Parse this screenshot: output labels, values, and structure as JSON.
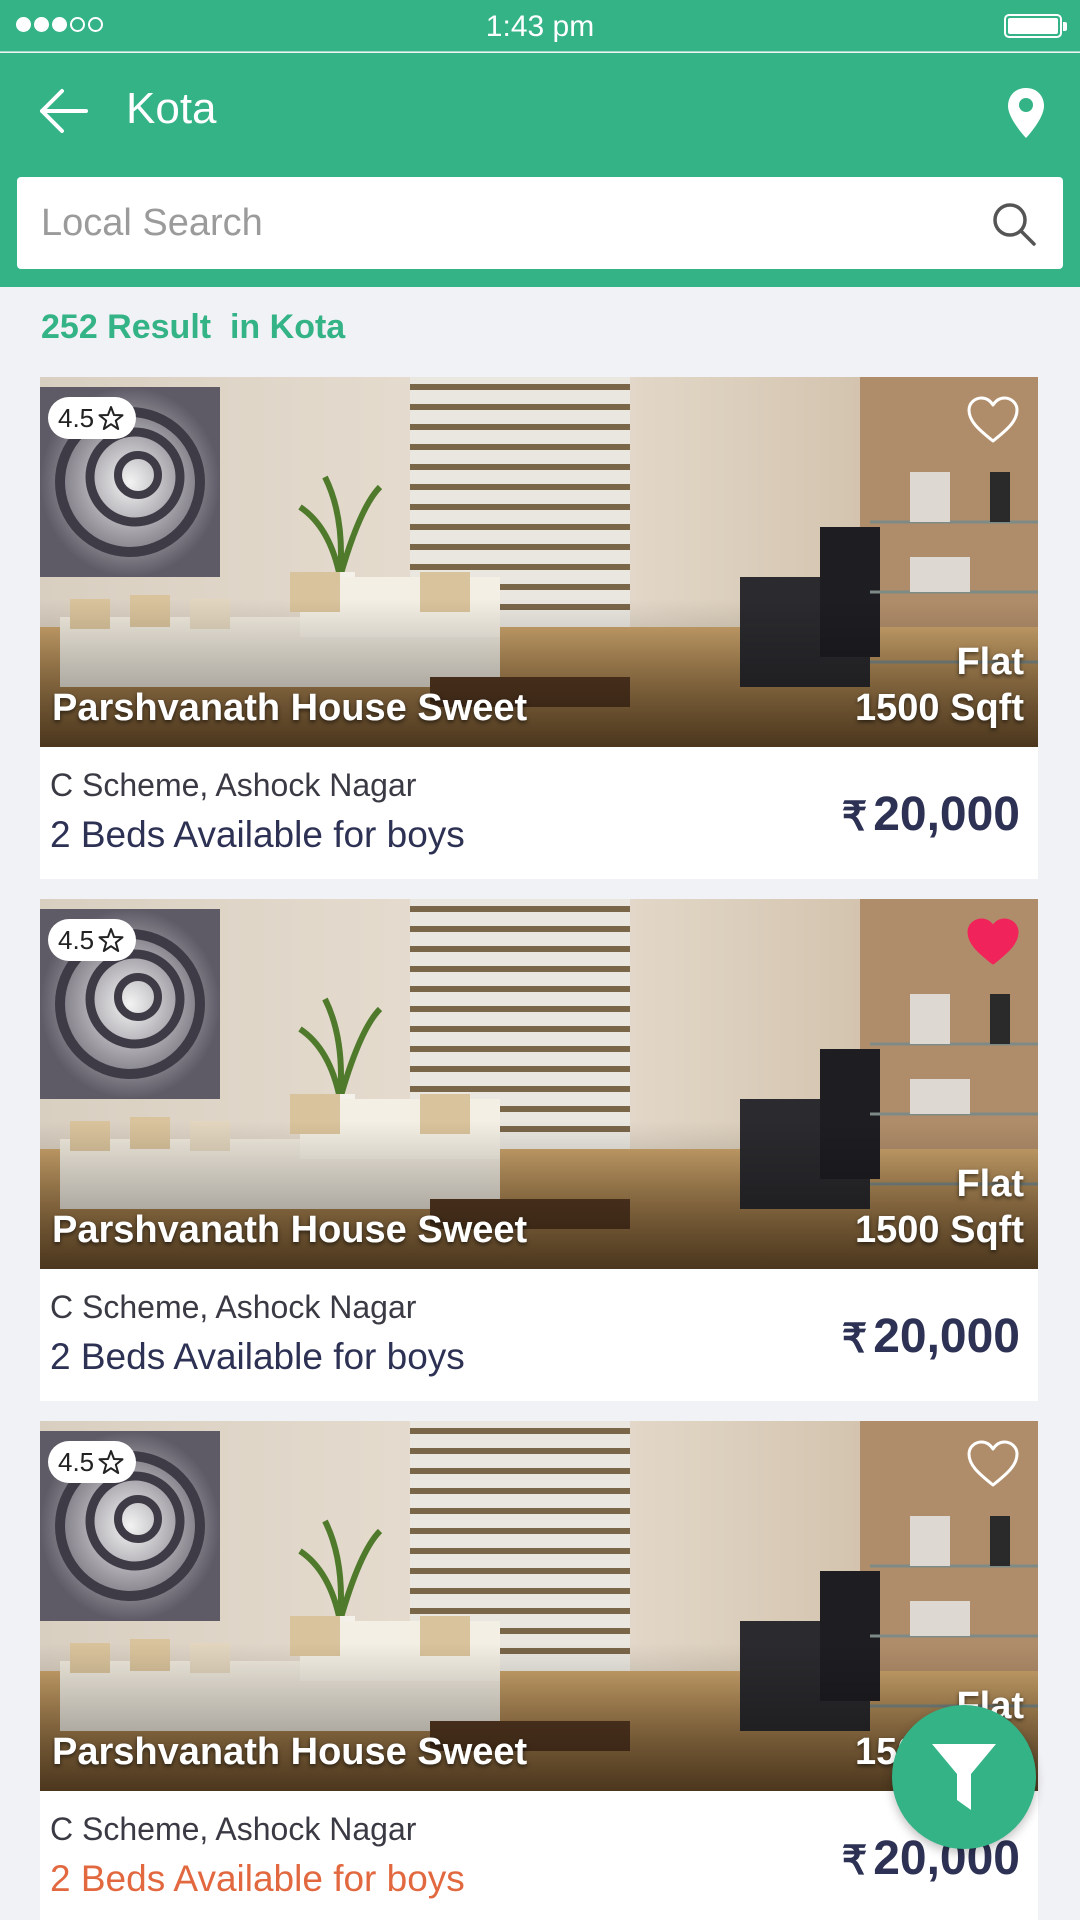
{
  "status_bar": {
    "time": "1:43 pm"
  },
  "header": {
    "title": "Kota"
  },
  "search": {
    "placeholder": "Local Search"
  },
  "results": {
    "summary": "252 Result  in Kota"
  },
  "listings": [
    {
      "rating": "4.5",
      "name": "Parshvanath House Sweet",
      "type": "Flat",
      "area": "1500 Sqft",
      "address": "C Scheme, Ashock Nagar",
      "beds": "2 Beds Available for boys",
      "currency": "₹",
      "price": "20,000",
      "favorited": false
    },
    {
      "rating": "4.5",
      "name": "Parshvanath House Sweet",
      "type": "Flat",
      "area": "1500 Sqft",
      "address": "C Scheme, Ashock Nagar",
      "beds": "2 Beds Available for boys",
      "currency": "₹",
      "price": "20,000",
      "favorited": true
    },
    {
      "rating": "4.5",
      "name": "Parshvanath House Sweet",
      "type": "Flat",
      "area": "1500 Sqft",
      "address": "C Scheme, Ashock Nagar",
      "beds": "2 Beds Available for boys",
      "currency": "₹",
      "price": "20,000",
      "favorited": false
    }
  ],
  "icons": {
    "back": "back-arrow-icon",
    "location": "location-pin-icon",
    "search": "search-icon",
    "rating": "star-outline-icon",
    "favorite": "heart-icon",
    "filter": "filter-funnel-icon"
  },
  "colors": {
    "primary": "#33b386",
    "favorite_active": "#f0245a",
    "text_dark": "#2d3154",
    "beds_alt": "#e1683f"
  }
}
